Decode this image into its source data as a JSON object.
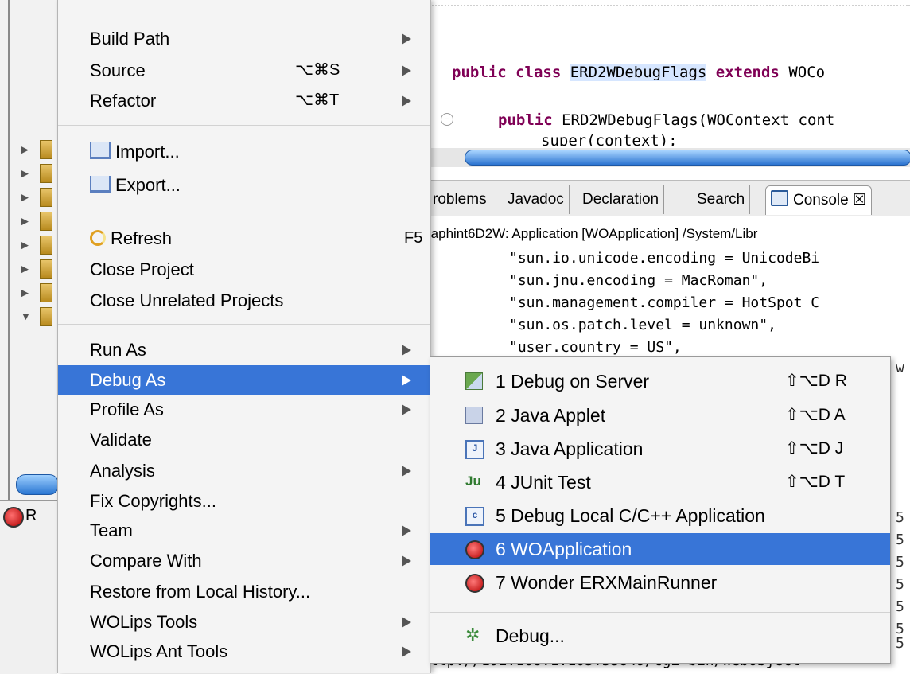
{
  "context_menu": {
    "items": [
      {
        "label": "Build Path",
        "shortcut": "",
        "submenu": true
      },
      {
        "label": "Source",
        "shortcut": "⌥⌘S",
        "submenu": true
      },
      {
        "label": "Refactor",
        "shortcut": "⌥⌘T",
        "submenu": true
      },
      {
        "label": "Import...",
        "icon": "import-icon"
      },
      {
        "label": "Export...",
        "icon": "export-icon"
      },
      {
        "label": "Refresh",
        "shortcut": "F5",
        "icon": "refresh-icon"
      },
      {
        "label": "Close Project"
      },
      {
        "label": "Close Unrelated Projects"
      },
      {
        "label": "Run As",
        "submenu": true
      },
      {
        "label": "Debug As",
        "submenu": true,
        "selected": true
      },
      {
        "label": "Profile As",
        "submenu": true
      },
      {
        "label": "Validate"
      },
      {
        "label": "Analysis",
        "submenu": true
      },
      {
        "label": "Fix Copyrights..."
      },
      {
        "label": "Team",
        "submenu": true
      },
      {
        "label": "Compare With",
        "submenu": true
      },
      {
        "label": "Restore from Local History..."
      },
      {
        "label": "WOLips Tools",
        "submenu": true
      },
      {
        "label": "WOLips Ant Tools",
        "submenu": true
      }
    ]
  },
  "debug_submenu": {
    "items": [
      {
        "label": "1 Debug on Server",
        "shortcut": "⇧⌥D R",
        "icon": "server-debug-icon"
      },
      {
        "label": "2 Java Applet",
        "shortcut": "⇧⌥D A",
        "icon": "java-applet-icon"
      },
      {
        "label": "3 Java Application",
        "shortcut": "⇧⌥D J",
        "icon": "java-application-icon",
        "icon_text": "J"
      },
      {
        "label": "4 JUnit Test",
        "shortcut": "⇧⌥D T",
        "icon": "junit-icon",
        "icon_text": "Ju"
      },
      {
        "label": "5 Debug Local C/C++ Application",
        "shortcut": "",
        "icon": "c-application-icon",
        "icon_text": "c"
      },
      {
        "label": "6 WOApplication",
        "shortcut": "",
        "icon": "woapplication-icon",
        "selected": true
      },
      {
        "label": "7 Wonder ERXMainRunner",
        "shortcut": "",
        "icon": "wonder-runner-icon"
      },
      {
        "label": "Debug...",
        "shortcut": "",
        "icon": "debug-gear-icon"
      }
    ]
  },
  "editor": {
    "line1_kw": "public class",
    "line1_name": "ERD2WDebugFlags",
    "line1_kw2": "extends",
    "line1_rest": "WOCo",
    "line2_kw": "public",
    "line2_rest": "ERD2WDebugFlags(WOContext cont",
    "line3": "super(context);"
  },
  "tabs": {
    "problems": "roblems",
    "javadoc": "Javadoc",
    "declaration": "Declaration",
    "search": "Search",
    "console": "Console ☒"
  },
  "console": {
    "header": "raphint6D2W: Application [WOApplication] /System/Libr",
    "lines": [
      "\"sun.io.unicode.encoding = UnicodeBi",
      "\"sun.jnu.encoding = MacRoman\",",
      "\"sun.management.compiler = HotSpot C",
      "\"sun.os.patch.level = unknown\",",
      "\"user.country = US\","
    ],
    "right_fragments": [
      "w",
      "5",
      "5",
      "5",
      "5",
      "5",
      "5",
      "5"
    ],
    "bottom_line": "ttp://192.168.1.103:53849/cgi-bin/WebObject"
  },
  "run_view": {
    "label": "R"
  }
}
